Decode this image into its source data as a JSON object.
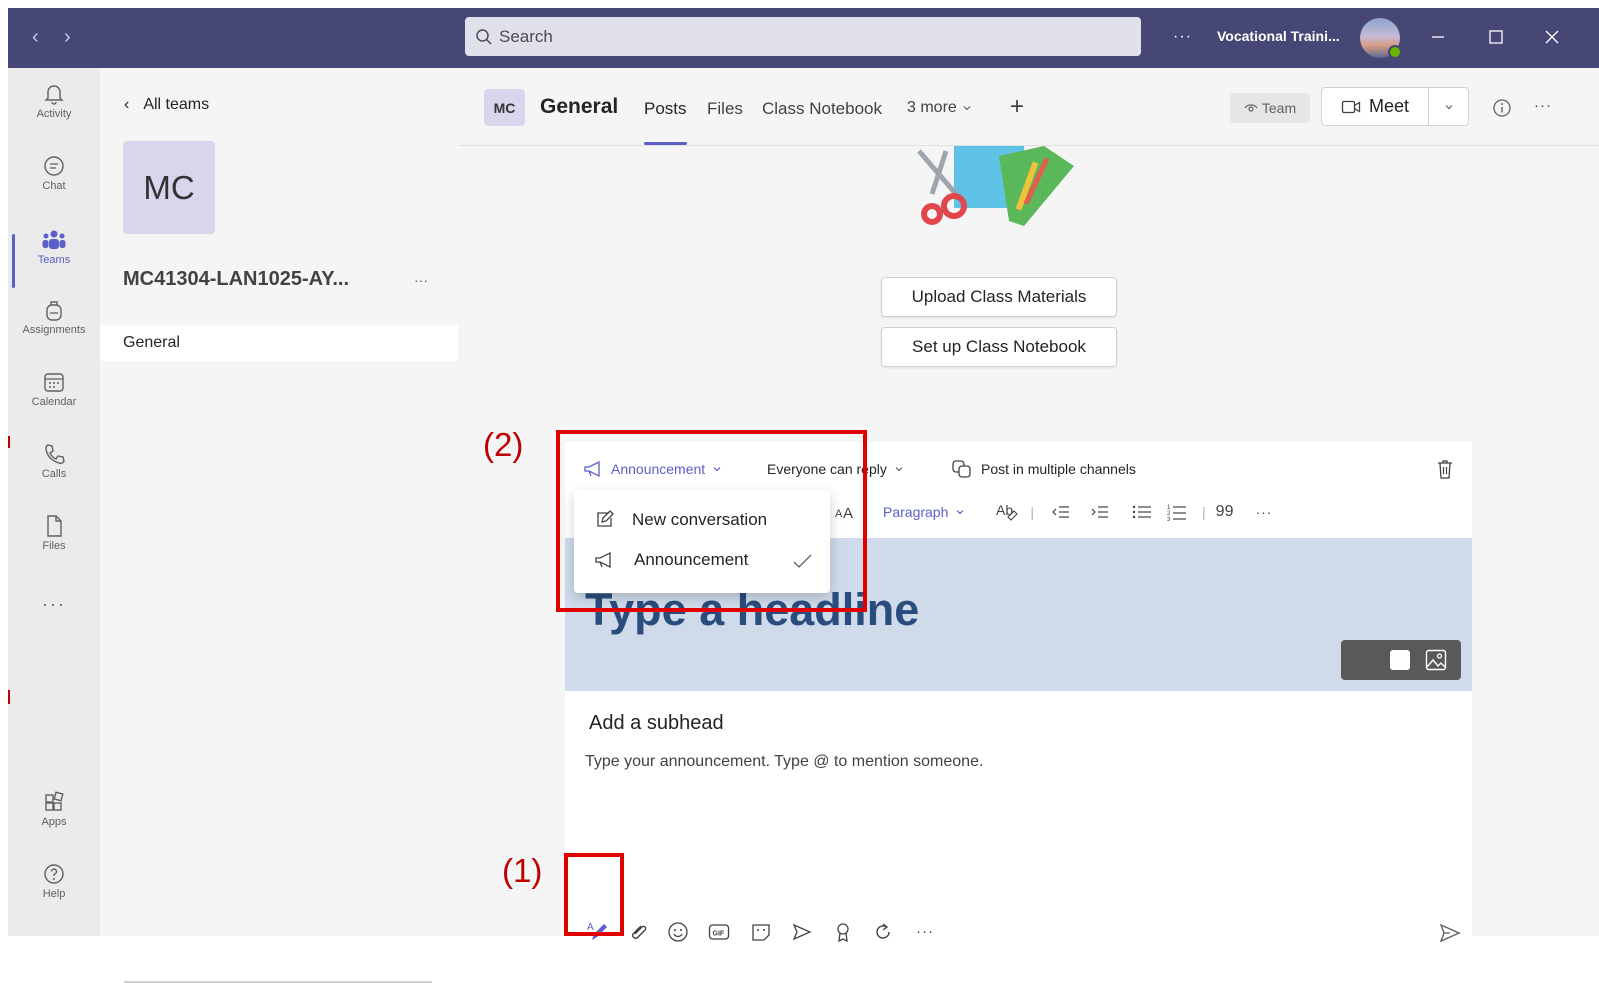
{
  "titlebar": {
    "search_placeholder": "Search",
    "more_label": "···",
    "org_name": "Vocational Traini..."
  },
  "rail": {
    "items": [
      {
        "label": "Activity",
        "icon": "bell-icon"
      },
      {
        "label": "Chat",
        "icon": "chat-icon"
      },
      {
        "label": "Teams",
        "icon": "teams-icon",
        "active": true
      },
      {
        "label": "Assignments",
        "icon": "backpack-icon"
      },
      {
        "label": "Calendar",
        "icon": "calendar-icon"
      },
      {
        "label": "Calls",
        "icon": "phone-icon"
      },
      {
        "label": "Files",
        "icon": "file-icon"
      }
    ],
    "more_label": "···",
    "apps_label": "Apps",
    "help_label": "Help"
  },
  "teams_panel": {
    "back_label": "All teams",
    "team_initials": "MC",
    "team_name": "MC41304-LAN1025-AY...",
    "team_more": "···",
    "channel": "General"
  },
  "channel_header": {
    "badge": "MC",
    "title": "General",
    "tabs": [
      "Posts",
      "Files",
      "Class Notebook",
      "3 more"
    ],
    "add_tab": "+",
    "team_button": "Team",
    "meet_button": "Meet",
    "more": "···"
  },
  "actions": {
    "upload": "Upload Class Materials",
    "notebook": "Set up Class Notebook"
  },
  "composer": {
    "post_type": "Announcement",
    "reply_setting": "Everyone can reply",
    "multi_channel": "Post in multiple channels",
    "paragraph": "Paragraph",
    "quote": "99",
    "more": "···",
    "headline_placeholder": "Type a headline",
    "subhead_placeholder": "Add a subhead",
    "body_placeholder": "Type your announcement. Type @ to mention someone."
  },
  "dropdown": {
    "items": [
      "New conversation",
      "Announcement"
    ],
    "selected": "Announcement"
  },
  "annotations": {
    "callout_1": "(1)",
    "callout_2": "(2)"
  },
  "colors": {
    "titlebar": "#464775",
    "accent": "#5b5fc7",
    "annotation": "#e00000",
    "headline_bg": "#cfdbea"
  }
}
